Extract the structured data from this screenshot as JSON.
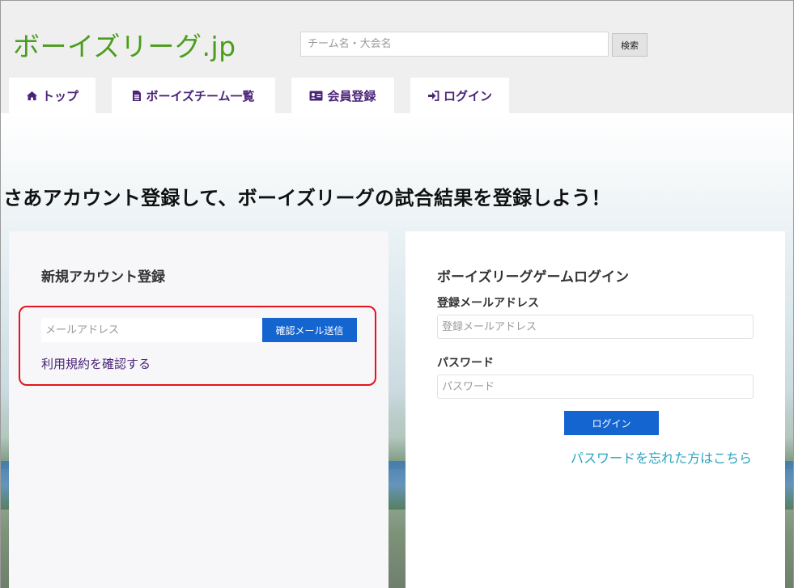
{
  "header": {
    "logo": "ボーイズリーグ.jp",
    "search": {
      "placeholder": "チーム名・大会名",
      "value": "",
      "button_label": "検索"
    }
  },
  "nav": {
    "tabs": [
      {
        "label": "トップ",
        "icon": "home-icon"
      },
      {
        "label": "ボーイズチーム一覧",
        "icon": "document-icon"
      },
      {
        "label": "会員登録",
        "icon": "id-card-icon"
      },
      {
        "label": "ログイン",
        "icon": "sign-in-icon"
      }
    ]
  },
  "main": {
    "headline": "さあアカウント登録して、ボーイズリーグの試合結果を登録しよう！",
    "register": {
      "title": "新規アカウント登録",
      "email_placeholder": "メールアドレス",
      "email_value": "",
      "send_button": "確認メール送信",
      "terms_link": "利用規約を確認する"
    },
    "login": {
      "title": "ボーイズリーグゲームログイン",
      "email_label": "登録メールアドレス",
      "email_placeholder": "登録メールアドレス",
      "email_value": "",
      "password_label": "パスワード",
      "password_placeholder": "パスワード",
      "password_value": "",
      "login_button": "ログイン",
      "forgot_link": "パスワードを忘れた方はこちら"
    }
  },
  "colors": {
    "logo": "#4a9e1c",
    "nav_text": "#4b2378",
    "button": "#1565d0",
    "highlight": "#e2141e",
    "forgot_link": "#2aa3c0"
  }
}
